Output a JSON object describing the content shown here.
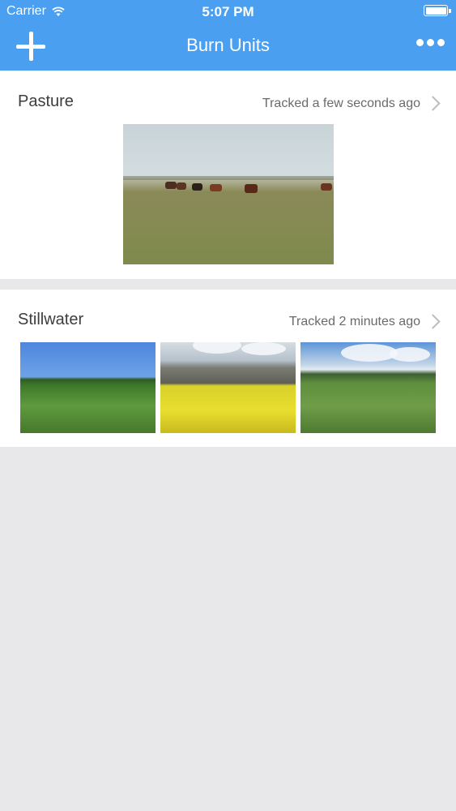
{
  "status_bar": {
    "carrier": "Carrier",
    "time": "5:07 PM",
    "battery_level": 1.0
  },
  "nav": {
    "title": "Burn Units",
    "add_icon": "plus-icon",
    "more_icon": "ellipsis-icon"
  },
  "burn_units": [
    {
      "name": "Pasture",
      "tracked": "Tracked a few seconds ago",
      "photos": [
        "pasture-with-cattle"
      ]
    },
    {
      "name": "Stillwater",
      "tracked": "Tracked 2 minutes ago",
      "photos": [
        "green-field-blue-sky",
        "yellow-flower-field",
        "green-field-cloudy-sky"
      ]
    }
  ],
  "colors": {
    "nav_background": "#4a9ff0",
    "page_background": "#e8e7ea",
    "card_background": "#ffffff"
  }
}
